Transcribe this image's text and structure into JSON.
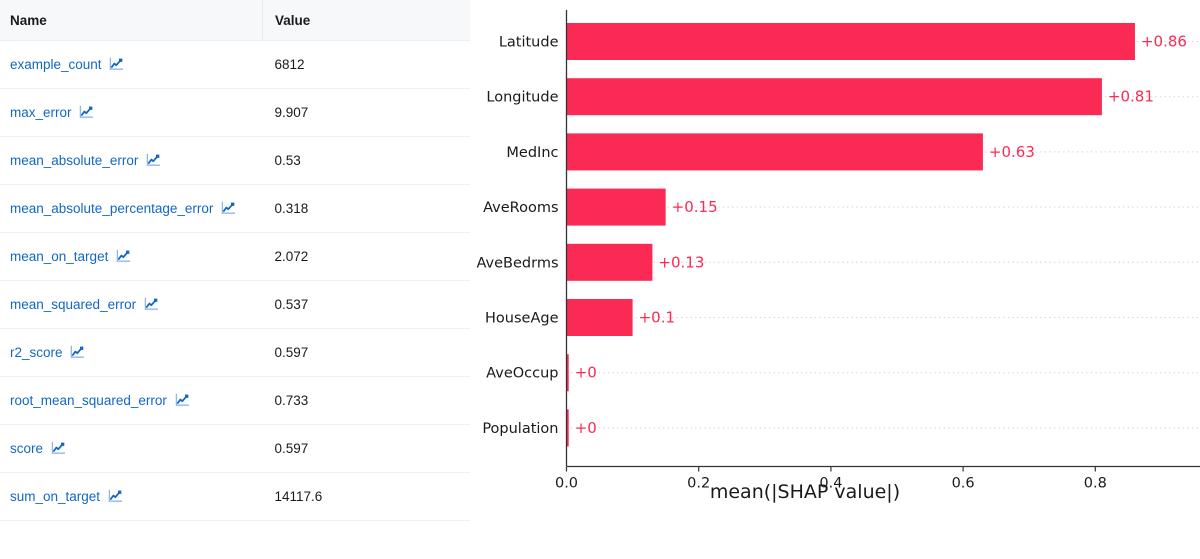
{
  "metrics_table": {
    "columns": [
      "Name",
      "Value"
    ],
    "link_color": "#1267c4",
    "icon_name": "chart-increasing-icon",
    "rows": [
      {
        "name": "example_count",
        "value": "6812"
      },
      {
        "name": "max_error",
        "value": "9.907"
      },
      {
        "name": "mean_absolute_error",
        "value": "0.53"
      },
      {
        "name": "mean_absolute_percentage_error",
        "value": "0.318"
      },
      {
        "name": "mean_on_target",
        "value": "2.072"
      },
      {
        "name": "mean_squared_error",
        "value": "0.537"
      },
      {
        "name": "r2_score",
        "value": "0.597"
      },
      {
        "name": "root_mean_squared_error",
        "value": "0.733"
      },
      {
        "name": "score",
        "value": "0.597"
      },
      {
        "name": "sum_on_target",
        "value": "14117.6"
      }
    ]
  },
  "chart_data": {
    "type": "bar",
    "orientation": "horizontal",
    "title": "",
    "xlabel": "mean(|SHAP value|)",
    "ylabel": "",
    "categories": [
      "Latitude",
      "Longitude",
      "MedInc",
      "AveRooms",
      "AveBedrms",
      "HouseAge",
      "AveOccup",
      "Population"
    ],
    "values": [
      0.86,
      0.81,
      0.63,
      0.15,
      0.13,
      0.1,
      0.0,
      0.0
    ],
    "data_labels": [
      "+0.86",
      "+0.81",
      "+0.63",
      "+0.15",
      "+0.13",
      "+0.1",
      "+0",
      "+0"
    ],
    "xticks": [
      0.0,
      0.2,
      0.4,
      0.6,
      0.8
    ],
    "xtick_labels": [
      "0.0",
      "0.2",
      "0.4",
      "0.6",
      "0.8"
    ],
    "xlim": [
      0.0,
      0.95
    ],
    "bar_color": "#fa2a55",
    "label_color": "#fa2a55",
    "grid": "dotted-horizontal",
    "legend": "none"
  }
}
